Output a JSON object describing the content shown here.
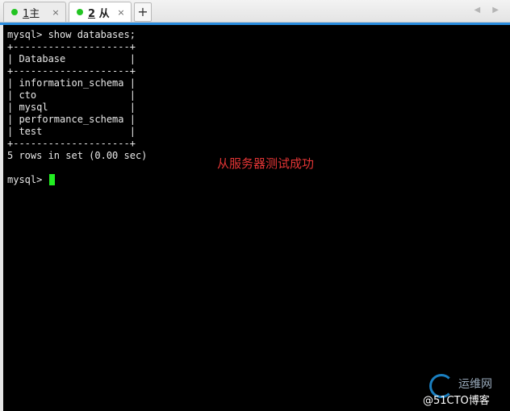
{
  "tabs": [
    {
      "num": "1",
      "name": "主"
    },
    {
      "num": "2",
      "name": "从"
    }
  ],
  "tab_close": "×",
  "new_tab": "+",
  "scroll_arrows": "◀ ▶",
  "terminal": {
    "lines": [
      "mysql> show databases;",
      "+--------------------+",
      "| Database           |",
      "+--------------------+",
      "| information_schema |",
      "| cto                |",
      "| mysql              |",
      "| performance_schema |",
      "| test               |",
      "+--------------------+",
      "5 rows in set (0.00 sec)",
      ""
    ],
    "prompt": "mysql> "
  },
  "annotation": "从服务器测试成功",
  "watermark": {
    "line1": "运维网",
    "line2": "@51CTO博客"
  },
  "colors": {
    "tab_accent": "#2a8de0",
    "cursor": "#22ee22",
    "annotation": "#e33535",
    "status_dot": "#22c422"
  }
}
